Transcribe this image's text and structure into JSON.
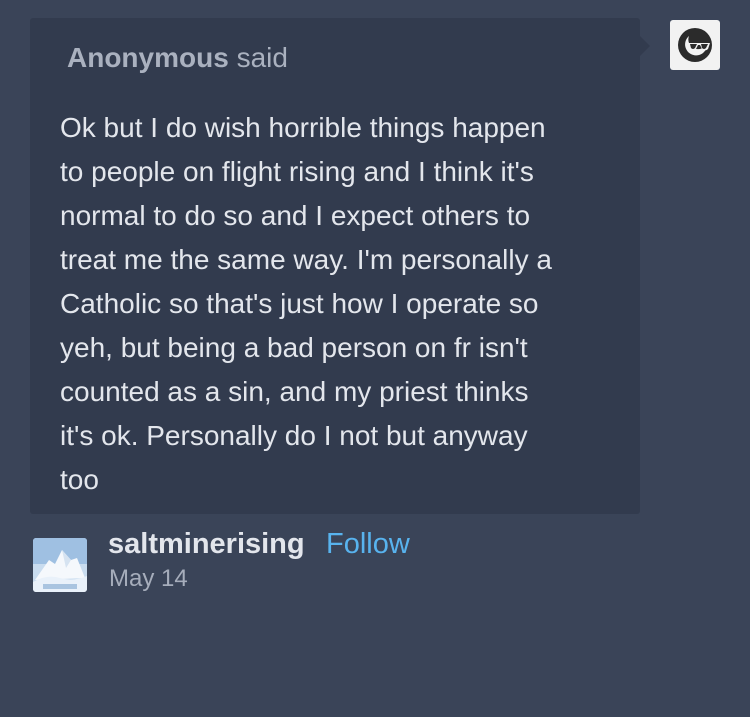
{
  "ask": {
    "asker_name": "Anonymous",
    "asker_verb": "said",
    "question": "Ok but I do wish horrible things happen\nto people on flight rising and I think it's\nnormal to do so and I expect others to\ntreat me the same way. I'm personally a\nCatholic so that's just how I operate so\nyeh, but being a bad person on fr isn't\ncounted as a sin, and my priest thinks\nit's ok. Personally do I not but anyway\ntoo",
    "avatar_icon": "anonymous-sunglasses-icon"
  },
  "answerer": {
    "username": "saltminerising",
    "follow_label": "Follow",
    "date": "May 14",
    "avatar_icon": "mountain-avatar-icon"
  },
  "colors": {
    "page_background": "#3a4458",
    "bubble_background": "#323b4e",
    "follow_link": "#58b3ee"
  }
}
